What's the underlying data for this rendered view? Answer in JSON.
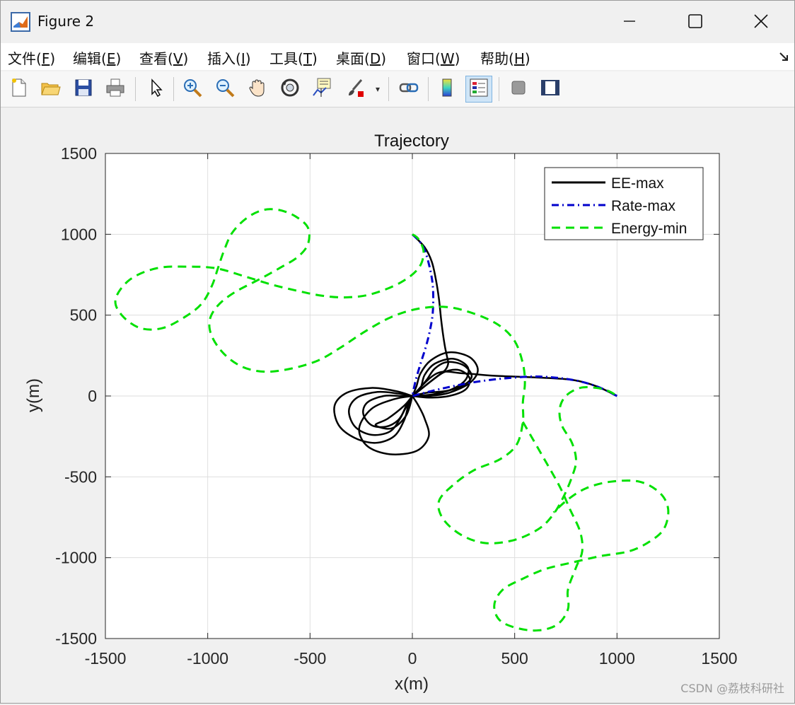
{
  "window": {
    "title": "Figure 2",
    "minimize_icon": "minimize-icon",
    "maximize_icon": "maximize-icon",
    "close_icon": "close-icon"
  },
  "menu": {
    "items": [
      {
        "label": "文件(F)",
        "text": "文件(",
        "key": "F",
        "suffix": ")"
      },
      {
        "label": "编辑(E)",
        "text": "编辑(",
        "key": "E",
        "suffix": ")"
      },
      {
        "label": "查看(V)",
        "text": "查看(",
        "key": "V",
        "suffix": ")"
      },
      {
        "label": "插入(I)",
        "text": "插入(",
        "key": "I",
        "suffix": ")"
      },
      {
        "label": "工具(T)",
        "text": "工具(",
        "key": "T",
        "suffix": ")"
      },
      {
        "label": "桌面(D)",
        "text": "桌面(",
        "key": "D",
        "suffix": ")"
      },
      {
        "label": "窗口(W)",
        "text": "窗口(",
        "key": "W",
        "suffix": ")"
      },
      {
        "label": "帮助(H)",
        "text": "帮助(",
        "key": "H",
        "suffix": ")"
      }
    ],
    "dock_icon": "dock-arrow-icon"
  },
  "toolbar": {
    "icons": [
      "new-figure-icon",
      "open-file-icon",
      "save-icon",
      "print-icon",
      "select-pointer-icon",
      "zoom-in-icon",
      "zoom-out-icon",
      "pan-hand-icon",
      "rotate-3d-icon",
      "data-cursor-icon",
      "brush-icon",
      "link-plot-icon",
      "colorbar-icon",
      "legend-icon",
      "hide-plot-tools-icon",
      "show-plot-tools-icon"
    ],
    "active": "legend-icon"
  },
  "chart_data": {
    "type": "line",
    "title": "Trajectory",
    "xlabel": "x(m)",
    "ylabel": "y(m)",
    "xlim": [
      -1500,
      1500
    ],
    "ylim": [
      -1500,
      1500
    ],
    "xticks": [
      -1500,
      -1000,
      -500,
      0,
      500,
      1000,
      1500
    ],
    "yticks": [
      -1500,
      -1000,
      -500,
      0,
      500,
      1000,
      1500
    ],
    "grid": true,
    "legend_position": "top-right",
    "series": [
      {
        "name": "EE-max",
        "color": "#000000",
        "style": "solid",
        "segments": [
          [
            [
              0,
              1000
            ],
            [
              60,
              920
            ],
            [
              95,
              830
            ],
            [
              115,
              720
            ],
            [
              130,
              600
            ],
            [
              140,
              480
            ],
            [
              150,
              380
            ],
            [
              160,
              300
            ],
            [
              170,
              240
            ],
            [
              175,
              200
            ],
            [
              160,
              160
            ],
            [
              120,
              120
            ],
            [
              80,
              80
            ],
            [
              40,
              40
            ],
            [
              0,
              0
            ]
          ],
          [
            [
              1000,
              0
            ],
            [
              900,
              60
            ],
            [
              780,
              100
            ],
            [
              600,
              115
            ],
            [
              400,
              125
            ],
            [
              250,
              140
            ],
            [
              120,
              140
            ],
            [
              0,
              0
            ]
          ],
          [
            [
              0,
              0
            ],
            [
              -80,
              30
            ],
            [
              -200,
              50
            ],
            [
              -320,
              20
            ],
            [
              -380,
              -60
            ],
            [
              -360,
              -180
            ],
            [
              -280,
              -260
            ],
            [
              -180,
              -290
            ],
            [
              -90,
              -250
            ],
            [
              -40,
              -150
            ],
            [
              -20,
              -60
            ],
            [
              0,
              0
            ]
          ],
          [
            [
              0,
              0
            ],
            [
              -70,
              15
            ],
            [
              -170,
              25
            ],
            [
              -270,
              -10
            ],
            [
              -310,
              -90
            ],
            [
              -280,
              -190
            ],
            [
              -200,
              -240
            ],
            [
              -110,
              -220
            ],
            [
              -60,
              -140
            ],
            [
              -30,
              -60
            ],
            [
              0,
              0
            ]
          ],
          [
            [
              0,
              0
            ],
            [
              -60,
              0
            ],
            [
              -140,
              0
            ],
            [
              -220,
              -40
            ],
            [
              -240,
              -110
            ],
            [
              -200,
              -180
            ],
            [
              -130,
              -190
            ],
            [
              -70,
              -150
            ],
            [
              -35,
              -80
            ],
            [
              0,
              0
            ]
          ],
          [
            [
              0,
              0
            ],
            [
              -90,
              -20
            ],
            [
              -200,
              -80
            ],
            [
              -260,
              -200
            ],
            [
              -220,
              -310
            ],
            [
              -110,
              -360
            ],
            [
              20,
              -340
            ],
            [
              80,
              -250
            ],
            [
              60,
              -140
            ],
            [
              30,
              -60
            ],
            [
              0,
              0
            ]
          ],
          [
            [
              0,
              0
            ],
            [
              -40,
              -60
            ],
            [
              -120,
              -140
            ],
            [
              -180,
              -180
            ],
            [
              -100,
              -200
            ],
            [
              -30,
              -120
            ],
            [
              0,
              0
            ]
          ],
          [
            [
              0,
              0
            ],
            [
              20,
              60
            ],
            [
              40,
              140
            ],
            [
              90,
              220
            ],
            [
              180,
              270
            ],
            [
              280,
              240
            ],
            [
              320,
              160
            ],
            [
              280,
              80
            ],
            [
              180,
              20
            ],
            [
              80,
              0
            ],
            [
              0,
              0
            ]
          ],
          [
            [
              0,
              0
            ],
            [
              40,
              50
            ],
            [
              60,
              130
            ],
            [
              110,
              200
            ],
            [
              200,
              230
            ],
            [
              270,
              180
            ],
            [
              260,
              100
            ],
            [
              190,
              40
            ],
            [
              100,
              10
            ],
            [
              0,
              0
            ]
          ],
          [
            [
              0,
              0
            ],
            [
              70,
              20
            ],
            [
              160,
              30
            ],
            [
              240,
              60
            ],
            [
              290,
              120
            ],
            [
              250,
              190
            ],
            [
              170,
              210
            ],
            [
              110,
              170
            ],
            [
              70,
              100
            ],
            [
              30,
              40
            ],
            [
              0,
              0
            ]
          ],
          [
            [
              0,
              0
            ],
            [
              80,
              -10
            ],
            [
              180,
              0
            ],
            [
              260,
              40
            ],
            [
              280,
              110
            ],
            [
              230,
              160
            ],
            [
              160,
              150
            ],
            [
              100,
              100
            ],
            [
              40,
              40
            ],
            [
              0,
              0
            ]
          ]
        ]
      },
      {
        "name": "Rate-max",
        "color": "#0000cc",
        "style": "dash-dot",
        "segments": [
          [
            [
              0,
              1000
            ],
            [
              50,
              930
            ],
            [
              80,
              820
            ],
            [
              100,
              680
            ],
            [
              100,
              520
            ],
            [
              85,
              400
            ],
            [
              65,
              300
            ],
            [
              40,
              200
            ],
            [
              15,
              90
            ],
            [
              0,
              0
            ]
          ],
          [
            [
              1000,
              0
            ],
            [
              900,
              60
            ],
            [
              780,
              100
            ],
            [
              620,
              120
            ],
            [
              460,
              110
            ],
            [
              300,
              85
            ],
            [
              160,
              50
            ],
            [
              60,
              20
            ],
            [
              0,
              0
            ]
          ]
        ]
      },
      {
        "name": "Energy-min",
        "color": "#00e000",
        "style": "dashed",
        "segments": [
          [
            [
              0,
              1000
            ],
            [
              30,
              970
            ],
            [
              55,
              890
            ],
            [
              30,
              790
            ],
            [
              -60,
              700
            ],
            [
              -200,
              630
            ],
            [
              -320,
              610
            ],
            [
              -440,
              620
            ],
            [
              -560,
              650
            ],
            [
              -690,
              690
            ],
            [
              -820,
              740
            ],
            [
              -960,
              790
            ],
            [
              -1100,
              800
            ],
            [
              -1250,
              790
            ],
            [
              -1380,
              720
            ],
            [
              -1450,
              600
            ],
            [
              -1420,
              500
            ],
            [
              -1330,
              420
            ],
            [
              -1220,
              420
            ],
            [
              -1110,
              490
            ],
            [
              -1030,
              570
            ],
            [
              -980,
              680
            ],
            [
              -950,
              790
            ],
            [
              -920,
              900
            ],
            [
              -880,
              1010
            ],
            [
              -810,
              1100
            ],
            [
              -730,
              1150
            ],
            [
              -650,
              1150
            ],
            [
              -570,
              1110
            ],
            [
              -510,
              1040
            ],
            [
              -510,
              940
            ],
            [
              -560,
              860
            ],
            [
              -650,
              790
            ],
            [
              -750,
              720
            ],
            [
              -870,
              640
            ],
            [
              -950,
              560
            ],
            [
              -990,
              470
            ],
            [
              -980,
              370
            ],
            [
              -920,
              260
            ],
            [
              -830,
              180
            ],
            [
              -720,
              150
            ],
            [
              -590,
              170
            ],
            [
              -460,
              220
            ],
            [
              -350,
              300
            ],
            [
              -230,
              400
            ],
            [
              -100,
              490
            ],
            [
              30,
              540
            ],
            [
              170,
              550
            ],
            [
              300,
              510
            ],
            [
              420,
              440
            ],
            [
              500,
              340
            ],
            [
              540,
              200
            ],
            [
              550,
              80
            ],
            [
              540,
              -40
            ],
            [
              540,
              -160
            ],
            [
              510,
              -300
            ],
            [
              430,
              -390
            ],
            [
              300,
              -460
            ],
            [
              200,
              -550
            ],
            [
              130,
              -650
            ],
            [
              150,
              -760
            ],
            [
              240,
              -860
            ],
            [
              360,
              -910
            ],
            [
              500,
              -890
            ],
            [
              620,
              -820
            ],
            [
              690,
              -730
            ],
            [
              740,
              -620
            ],
            [
              780,
              -500
            ],
            [
              800,
              -400
            ],
            [
              780,
              -290
            ],
            [
              730,
              -180
            ],
            [
              720,
              -80
            ],
            [
              750,
              0
            ],
            [
              820,
              50
            ],
            [
              900,
              50
            ],
            [
              960,
              30
            ],
            [
              1000,
              0
            ]
          ],
          [
            [
              540,
              -160
            ],
            [
              640,
              -380
            ],
            [
              720,
              -560
            ],
            [
              770,
              -700
            ],
            [
              820,
              -840
            ],
            [
              830,
              -960
            ],
            [
              800,
              -1060
            ],
            [
              760,
              -1200
            ],
            [
              760,
              -1320
            ],
            [
              700,
              -1420
            ],
            [
              580,
              -1450
            ],
            [
              440,
              -1400
            ],
            [
              400,
              -1300
            ],
            [
              440,
              -1200
            ],
            [
              540,
              -1130
            ],
            [
              650,
              -1070
            ],
            [
              780,
              -1030
            ],
            [
              920,
              -990
            ],
            [
              1060,
              -960
            ],
            [
              1160,
              -900
            ],
            [
              1230,
              -820
            ],
            [
              1250,
              -700
            ],
            [
              1210,
              -600
            ],
            [
              1110,
              -530
            ],
            [
              970,
              -530
            ],
            [
              850,
              -570
            ],
            [
              760,
              -640
            ],
            [
              690,
              -720
            ]
          ]
        ]
      }
    ]
  },
  "watermark": "CSDN @荔枝科研社"
}
